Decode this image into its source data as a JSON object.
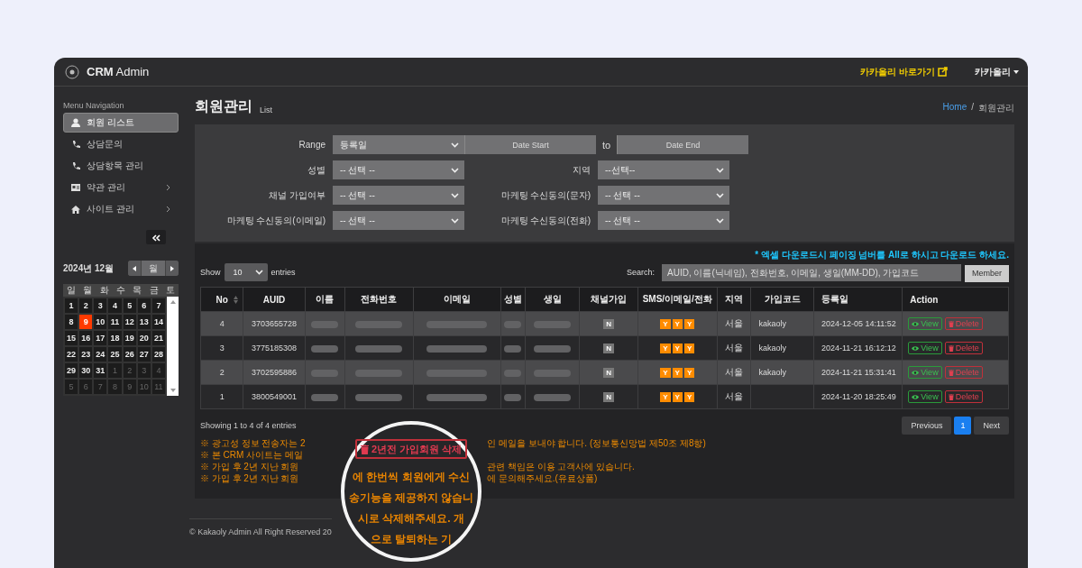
{
  "header": {
    "brand_bold": "CRM",
    "brand": "Admin",
    "shortcut": "카카올리 바로가기",
    "user": "카카올리"
  },
  "sidebar": {
    "heading": "Menu Navigation",
    "items": [
      {
        "label": "회원 리스트",
        "kind": "user",
        "selected": true,
        "submenu": false
      },
      {
        "label": "상담문의",
        "kind": "phone",
        "selected": false,
        "submenu": false
      },
      {
        "label": "상담항목 관리",
        "kind": "phone",
        "selected": false,
        "submenu": false
      },
      {
        "label": "약관 관리",
        "kind": "card",
        "selected": false,
        "submenu": true
      },
      {
        "label": "사이트 관리",
        "kind": "home",
        "selected": false,
        "submenu": true
      }
    ]
  },
  "calendar": {
    "title": "2024년 12월",
    "view": "월",
    "weekdays": [
      "일",
      "월",
      "화",
      "수",
      "목",
      "금",
      "토"
    ],
    "weeks": [
      [
        {
          "d": "1",
          "outside": false,
          "selected": false
        },
        {
          "d": "2",
          "outside": false,
          "selected": false
        },
        {
          "d": "3",
          "outside": false,
          "selected": false
        },
        {
          "d": "4",
          "outside": false,
          "selected": false
        },
        {
          "d": "5",
          "outside": false,
          "selected": false
        },
        {
          "d": "6",
          "outside": false,
          "selected": false
        },
        {
          "d": "7",
          "outside": false,
          "selected": false
        }
      ],
      [
        {
          "d": "8",
          "outside": false,
          "selected": false
        },
        {
          "d": "9",
          "outside": false,
          "selected": true
        },
        {
          "d": "10",
          "outside": false,
          "selected": false
        },
        {
          "d": "11",
          "outside": false,
          "selected": false
        },
        {
          "d": "12",
          "outside": false,
          "selected": false
        },
        {
          "d": "13",
          "outside": false,
          "selected": false
        },
        {
          "d": "14",
          "outside": false,
          "selected": false
        }
      ],
      [
        {
          "d": "15",
          "outside": false,
          "selected": false
        },
        {
          "d": "16",
          "outside": false,
          "selected": false
        },
        {
          "d": "17",
          "outside": false,
          "selected": false
        },
        {
          "d": "18",
          "outside": false,
          "selected": false
        },
        {
          "d": "19",
          "outside": false,
          "selected": false
        },
        {
          "d": "20",
          "outside": false,
          "selected": false
        },
        {
          "d": "21",
          "outside": false,
          "selected": false
        }
      ],
      [
        {
          "d": "22",
          "outside": false,
          "selected": false
        },
        {
          "d": "23",
          "outside": false,
          "selected": false
        },
        {
          "d": "24",
          "outside": false,
          "selected": false
        },
        {
          "d": "25",
          "outside": false,
          "selected": false
        },
        {
          "d": "26",
          "outside": false,
          "selected": false
        },
        {
          "d": "27",
          "outside": false,
          "selected": false
        },
        {
          "d": "28",
          "outside": false,
          "selected": false
        }
      ],
      [
        {
          "d": "29",
          "outside": false,
          "selected": false
        },
        {
          "d": "30",
          "outside": false,
          "selected": false
        },
        {
          "d": "31",
          "outside": false,
          "selected": false
        },
        {
          "d": "1",
          "outside": true,
          "selected": false
        },
        {
          "d": "2",
          "outside": true,
          "selected": false
        },
        {
          "d": "3",
          "outside": true,
          "selected": false
        },
        {
          "d": "4",
          "outside": true,
          "selected": false
        }
      ],
      [
        {
          "d": "5",
          "outside": true,
          "selected": false
        },
        {
          "d": "6",
          "outside": true,
          "selected": false
        },
        {
          "d": "7",
          "outside": true,
          "selected": false
        },
        {
          "d": "8",
          "outside": true,
          "selected": false
        },
        {
          "d": "9",
          "outside": true,
          "selected": false
        },
        {
          "d": "10",
          "outside": true,
          "selected": false
        },
        {
          "d": "11",
          "outside": true,
          "selected": false
        }
      ]
    ]
  },
  "page": {
    "title": "회원관리",
    "subtitle": "List",
    "breadcrumb": [
      "Home",
      "회원관리"
    ],
    "breadcrumb_separator": "/"
  },
  "filter_rows": [
    [
      {
        "kind": "range",
        "label": "Range",
        "value": "등록일",
        "start_placeholder": "Date Start",
        "to": "to",
        "end_placeholder": "Date End"
      }
    ],
    [
      {
        "kind": "select",
        "label": "성별",
        "value": "-- 선택 --"
      },
      {
        "kind": "select",
        "label": "지역",
        "value": "--선택--"
      }
    ],
    [
      {
        "kind": "select",
        "label": "채널 가입여부",
        "value": "-- 선택 --"
      },
      {
        "kind": "select",
        "label": "마케팅 수신동의(문자)",
        "value": "-- 선택 --"
      }
    ],
    [
      {
        "kind": "select",
        "label": "마케팅 수신동의(이메일)",
        "value": "-- 선택 --"
      },
      {
        "kind": "select",
        "label": "마케팅 수신동의(전화)",
        "value": "-- 선택 --"
      }
    ]
  ],
  "excel_note": "* 엑셀 다운로드시 페이징 넘버를 All로 하시고 다운로드 하세요.",
  "length": {
    "before": "Show",
    "value": "10",
    "after": "entries"
  },
  "search": {
    "label": "Search:",
    "placeholder": "AUID, 이름(닉네임), 전화번호, 이메일, 생일(MM-DD), 가입코드",
    "button": "Member"
  },
  "table": {
    "columns": [
      {
        "label": "No",
        "kind": "no",
        "sortable": true
      },
      {
        "label": "AUID",
        "kind": "auid",
        "sortable": false
      },
      {
        "label": "이름",
        "kind": "redacted",
        "sortable": false
      },
      {
        "label": "전화번호",
        "kind": "redacted",
        "sortable": false
      },
      {
        "label": "이메일",
        "kind": "redacted",
        "sortable": false
      },
      {
        "label": "성별",
        "kind": "redacted",
        "sortable": false
      },
      {
        "label": "생일",
        "kind": "redacted",
        "sortable": false
      },
      {
        "label": "채널가입",
        "kind": "channel",
        "sortable": false
      },
      {
        "label": "SMS/이메일/전화",
        "kind": "sms",
        "sortable": false
      },
      {
        "label": "지역",
        "kind": "region",
        "sortable": false
      },
      {
        "label": "가입코드",
        "kind": "code",
        "sortable": false
      },
      {
        "label": "등록일",
        "kind": "date",
        "sortable": false
      },
      {
        "label": "Action",
        "kind": "actions",
        "sortable": false
      }
    ],
    "rows": [
      {
        "no": "4",
        "auid": "3703655728",
        "channel": "N",
        "sms": [
          "Y",
          "Y",
          "Y"
        ],
        "region": "서울",
        "code": "kakaoly",
        "date": "2024-12-05 14:11:52",
        "actions": [
          "View",
          "Delete"
        ]
      },
      {
        "no": "3",
        "auid": "3775185308",
        "channel": "N",
        "sms": [
          "Y",
          "Y",
          "Y"
        ],
        "region": "서울",
        "code": "kakaoly",
        "date": "2024-11-21 16:12:12",
        "actions": [
          "View",
          "Delete"
        ]
      },
      {
        "no": "2",
        "auid": "3702595886",
        "channel": "N",
        "sms": [
          "Y",
          "Y",
          "Y"
        ],
        "region": "서울",
        "code": "kakaoly",
        "date": "2024-11-21 15:31:41",
        "actions": [
          "View",
          "Delete"
        ]
      },
      {
        "no": "1",
        "auid": "3800549001",
        "channel": "N",
        "sms": [
          "Y",
          "Y",
          "Y"
        ],
        "region": "서울",
        "date": "2024-11-20 18:25:49",
        "actions": [
          "View",
          "Delete"
        ]
      }
    ]
  },
  "info": "Showing 1 to 4 of 4 entries",
  "pagination": [
    {
      "label": "Previous",
      "selected": false
    },
    {
      "label": "1",
      "selected": true
    },
    {
      "label": "Next",
      "selected": false
    }
  ],
  "notes": [
    {
      "start": "※ 광고성 정보 전송자는 2",
      "end": "인 메일을 보내야 합니다. (정보통신망법 제50조 제8항)"
    },
    {
      "start": "※ 본 CRM 사이트는 메일"
    },
    {
      "start": "※ 가입 후 2년 지난 회원",
      "end": "관련 책임은 이용 고객사에 있습니다."
    },
    {
      "start": "※ 가입 후 2년 지난 회원",
      "end": "에 문의해주세요.(유료상품)"
    }
  ],
  "footer": "© Kakaoly Admin All Right Reserved 20",
  "magnifier": {
    "button": "2년전 가입회원 삭제",
    "lines": [
      "에 한번씩 회원에게 수신",
      "송기능을 제공하지 않습니",
      "시로 삭제해주세요. 개",
      "으로 탈퇴하는 기"
    ]
  }
}
